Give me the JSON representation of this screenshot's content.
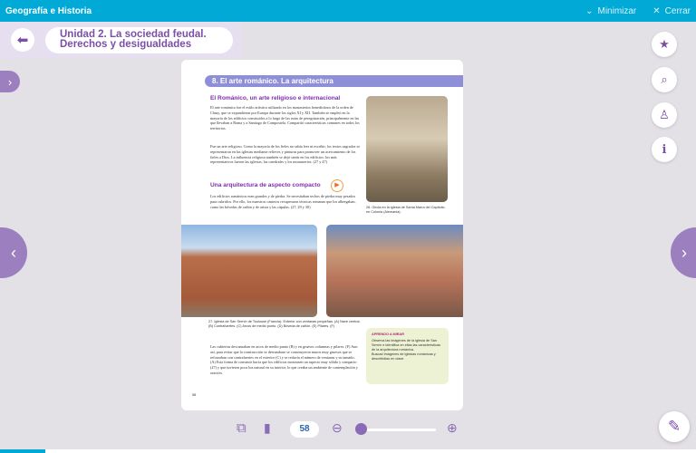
{
  "app": {
    "title": "Geografía e Historia",
    "minimize": "Minimizar",
    "close": "Cerrar"
  },
  "header": {
    "unit_line1": "Unidad 2. La sociedad feudal.",
    "unit_line2": "Derechos y desigualdades"
  },
  "page": {
    "section_title": "8. El arte románico. La arquitectura",
    "heading1": "El Románico, un arte religioso e internacional",
    "para1": "El arte románico fue el estilo artístico utilizado en los monasterios benedictinos de la orden de Cluny, que se expandieron por Europa durante los siglos XI y XII. También se empleó en la mayoría de los edificios construidos a lo largo de las rutas de peregrinación, principalmente en las que llevaban a Roma y a Santiago de Compostela. Compartió características comunes en todos los territorios.",
    "para2": "Fue un arte religioso. Como la mayoría de los fieles no sabía leer ni escribir, los textos sagrados se representaron en las iglesias mediante relieves y pinturas para promover un acercamiento de los fieles a Dios. La influencia religiosa también se dejó sentir en los edificios: los más representativos fueron las iglesias, las catedrales y los monasterios. (27 y 47)",
    "heading2": "Una arquitectura de aspecto compacto",
    "para3": "Los edificios románicos eran grandes y de piedra. Se necesitaban techos de piedra muy pesados para cubrirlos. Por ello, los maestros canteros recuperaron técnicas romanas que los albergaban, como las bóvedas de cañón y de arista y las cúpulas. (27, 29 y 30)",
    "caption1": "26. Girola en la iglesia de Santa María del Capitolio, en Colonia (Alemania).",
    "caption2": "27. Iglesia de San Sernín de Toulouse (Francia). Exterior con ventanas pequeñas. (A) Nave central. (B) Contrafuertes. (C) Arcos de medio punto. (D) Bóveda de cañón. (E) Pilares. (F)",
    "para4": "Las cubiertas descansaban en arcos de medio punto (B) y en gruesos columnas y pilares. (F) Aun así, para evitar que la construcción se derrumbase se construyeron muros muy gruesos que se reforzaban con contrafuertes en el exterior (C) y se reducía el número de ventanas y su tamaño. (A) Esta forma de construir hacía que los edificios mostrasen un aspecto muy sólido y compacto (27) y que tuviesen poca luz natural en su interior, lo que creaba un ambiente de contemplación y oración.",
    "box_title": "APRENDO A MIRAR",
    "box_item1": "Observa las imágenes de la iglesia de San Sernín e identifica en ellas las características de la arquitectura románica.",
    "box_item2": "Buscad imágenes de iglesias románicas y describidlas en clase.",
    "folio": "58"
  },
  "toolbar": {
    "page_number": "58",
    "zoom_fraction": 0.05
  },
  "progress": 0.065,
  "colors": {
    "topbar": "#00a9d6",
    "accent": "#7b4fa6"
  }
}
